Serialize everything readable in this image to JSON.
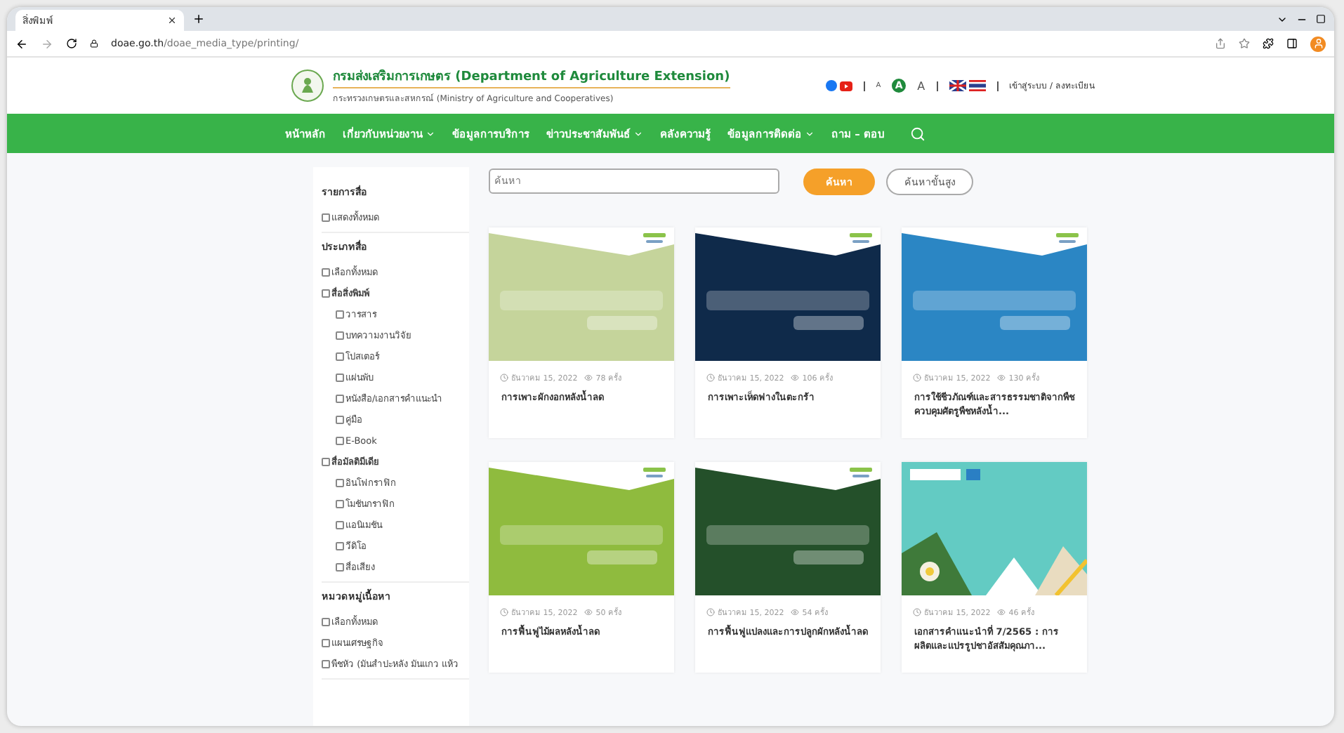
{
  "browser": {
    "tab_title": "สิ่งพิมพ์",
    "url_domain": "doae.go.th",
    "url_path": "/doae_media_type/printing/"
  },
  "header": {
    "title": "กรมส่งเสริมการเกษตร (Department of Agriculture Extension)",
    "subtitle": "กระทรวงเกษตรและสหกรณ์ (Ministry of Agriculture and Cooperatives)",
    "font_sizes": [
      {
        "label": "A",
        "selected": false
      },
      {
        "label": "A",
        "selected": true
      },
      {
        "label": "A",
        "selected": false
      }
    ],
    "login": "เข้าสู่ระบบ / ลงทะเบียน"
  },
  "nav": [
    {
      "label": "หน้าหลัก",
      "dropdown": false
    },
    {
      "label": "เกี่ยวกับหน่วยงาน",
      "dropdown": true
    },
    {
      "label": "ข้อมูลการบริการ",
      "dropdown": false
    },
    {
      "label": "ข่าวประชาสัมพันธ์",
      "dropdown": true
    },
    {
      "label": "คลังความรู้",
      "dropdown": false
    },
    {
      "label": "ข้อมูลการติดต่อ",
      "dropdown": true
    },
    {
      "label": "ถาม – ตอบ",
      "dropdown": false
    }
  ],
  "sidebar": {
    "sections": [
      {
        "heading": "รายการสื่อ",
        "items": [
          {
            "label": "แสดงทั้งหมด",
            "checked": false
          }
        ]
      },
      {
        "heading": "ประเภทสื่อ",
        "items": [
          {
            "label": "เลือกทั้งหมด",
            "checked": false
          },
          {
            "label": "สื่อสิ่งพิมพ์",
            "checked": false,
            "children": [
              {
                "label": "วารสาร",
                "checked": false
              },
              {
                "label": "บทความงานวิจัย",
                "checked": false
              },
              {
                "label": "โปสเตอร์",
                "checked": false
              },
              {
                "label": "แผ่นพับ",
                "checked": false
              },
              {
                "label": "หนังสือ/เอกสารคำแนะนำ",
                "checked": false
              },
              {
                "label": "คู่มือ",
                "checked": false
              },
              {
                "label": "E-Book",
                "checked": false
              }
            ]
          },
          {
            "label": "สื่อมัลติมีเดีย",
            "checked": false,
            "children": [
              {
                "label": "อินโฟกราฟิก",
                "checked": false
              },
              {
                "label": "โมชันกราฟิก",
                "checked": false
              },
              {
                "label": "แอนิเมชัน",
                "checked": false
              },
              {
                "label": "วีดิโอ",
                "checked": false
              },
              {
                "label": "สื่อเสียง",
                "checked": false
              }
            ]
          }
        ]
      },
      {
        "heading": "หมวดหมู่เนื้อหา",
        "items": [
          {
            "label": "เลือกทั้งหมด",
            "checked": false
          },
          {
            "label": "แผนเศรษฐกิจ",
            "checked": false
          },
          {
            "label": "พืชหัว (มันสำปะหลัง มันแกว แห้ว",
            "checked": false
          }
        ]
      }
    ]
  },
  "search": {
    "placeholder": "ค้นหา",
    "button": "ค้นหา",
    "advanced": "ค้นหาขั้นสูง"
  },
  "cards": [
    {
      "date": "ธันวาคม 15, 2022",
      "views": "78 ครั้ง",
      "title": "การเพาะผักงอกหลังน้ำลด"
    },
    {
      "date": "ธันวาคม 15, 2022",
      "views": "106 ครั้ง",
      "title": "การเพาะเห็ดฟางในตะกร้า"
    },
    {
      "date": "ธันวาคม 15, 2022",
      "views": "130 ครั้ง",
      "title": "การใช้ชีวภัณฑ์และสารธรรมชาติจากพืชควบคุมศัตรูพืชหลังน้ำ..."
    },
    {
      "date": "ธันวาคม 15, 2022",
      "views": "50 ครั้ง",
      "title": "การฟื้นฟูไม้ผลหลังน้ำลด"
    },
    {
      "date": "ธันวาคม 15, 2022",
      "views": "54 ครั้ง",
      "title": "การฟื้นฟูแปลงและการปลูกผักหลังน้ำลด"
    },
    {
      "date": "ธันวาคม 15, 2022",
      "views": "46 ครั้ง",
      "title": "เอกสารคำแนะนำที่ 7/2565 : การผลิตและแปรรูปชาอัสสัมคุณภา..."
    }
  ]
}
